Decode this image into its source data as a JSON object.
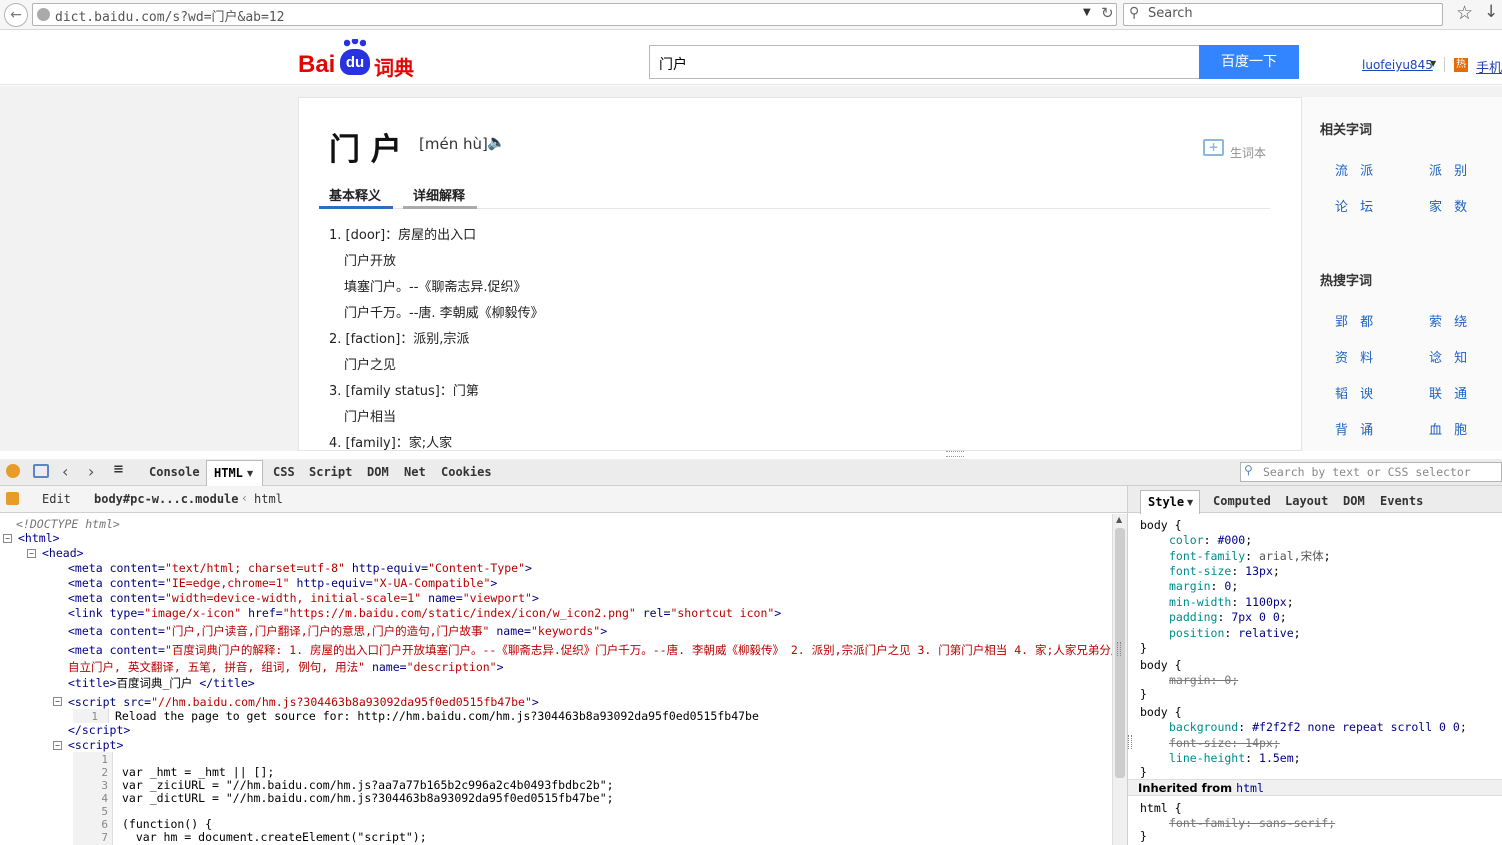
{
  "browser": {
    "url": "dict.baidu.com/s?wd=门户&ab=12",
    "search_placeholder": "Search"
  },
  "header": {
    "logo": "Bai",
    "logo2": "du",
    "logo3": "词典",
    "query": "门户",
    "search_button": "百度一下",
    "user": "luofeiyu845",
    "mobile": "手机"
  },
  "entry": {
    "word": "门 户",
    "pinyin": "[mén hù]",
    "wordbook": "生词本",
    "tab_basic": "基本释义",
    "tab_detail": "详细解释",
    "definitions": [
      "1. [door]：房屋的出入口",
      "门户开放",
      "填塞门户。--《聊斋志异.促织》",
      "门户千万。--唐. 李朝威《柳毅传》",
      "2. [faction]：派别,宗派",
      "门户之见",
      "3. [family status]：门第",
      "门户相当",
      "4. [family]：家;人家"
    ]
  },
  "sidebar": {
    "related_title": "相关字词",
    "related": [
      "流 派",
      "派 别",
      "论 坛",
      "家 数"
    ],
    "hot_title": "热搜字词",
    "hot": [
      "郢 都",
      "萦 绕",
      "资 料",
      "谂 知",
      "韬 谀",
      "联 通",
      "背 诵",
      "血 胞"
    ]
  },
  "firebug": {
    "tabs": [
      "Console",
      "HTML",
      "CSS",
      "Script",
      "DOM",
      "Net",
      "Cookies"
    ],
    "search_placeholder": "Search by text or CSS selector",
    "edit": "Edit",
    "breadcrumb1": "body#pc-w...c.module",
    "breadcrumb2": "html",
    "side_tabs": [
      "Style",
      "Computed",
      "Layout",
      "DOM",
      "Events"
    ]
  }
}
